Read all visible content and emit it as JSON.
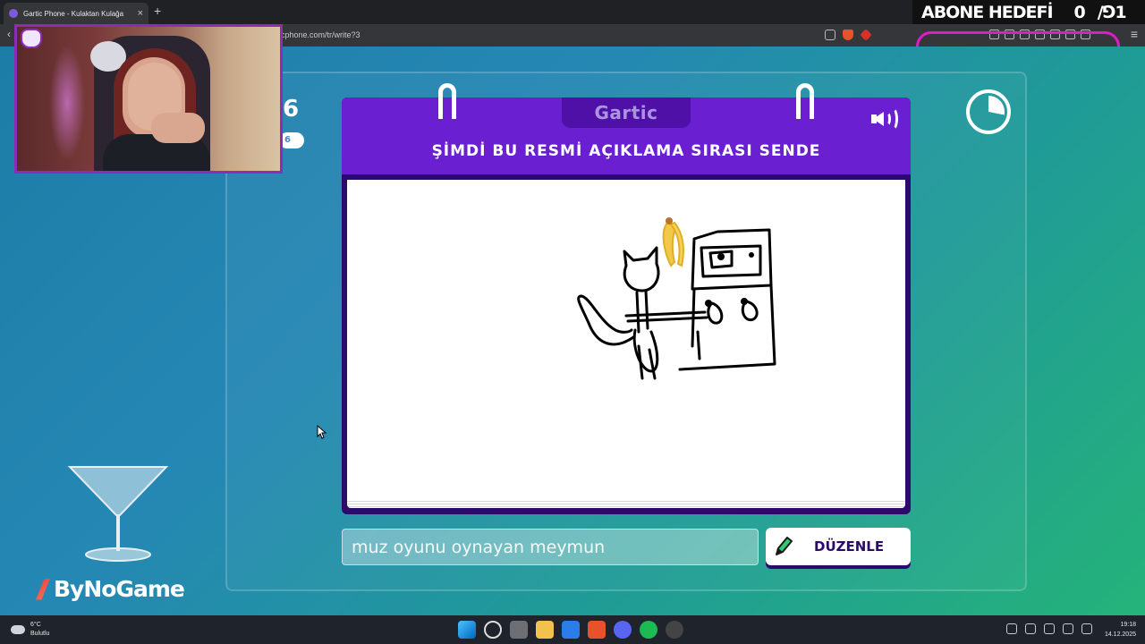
{
  "browser": {
    "tab_title": "Gartic Phone - Kulaktan Kulağa",
    "tab_close": "×",
    "new_tab": "+",
    "url": "garticphone.com/tr/write?3",
    "url_visible": "cphone.com/tr/write?3",
    "back": "‹",
    "menu": "≡"
  },
  "overlay": {
    "goal_label": "ABONE HEDEFİ",
    "goal_current": "0",
    "goal_target": "/0 1",
    "goal_target_visible": "/⅁1"
  },
  "game": {
    "logo": "Gartic",
    "prompt": "ŞİMDİ BU RESMİ AÇIKLAMA SIRASI SENDE",
    "round_number": "6",
    "round_total": "6",
    "guess_value": "muz oyunu oynayan meymun",
    "edit_button": "DÜZENLE",
    "sound_icon": "speaker-icon",
    "timer_icon": "timer-icon",
    "timer_progress": 0.28
  },
  "branding": {
    "sponsor": "ByNoGame"
  },
  "taskbar": {
    "temperature": "6°C",
    "weather": "Bulutlu",
    "time": "19:18",
    "date": "14.12.2025"
  },
  "colors": {
    "card_header": "#6a1fd0",
    "card_body": "#2b0a6b",
    "cam_border": "#8e2bb8",
    "goal_ring": "#e21bc7"
  }
}
